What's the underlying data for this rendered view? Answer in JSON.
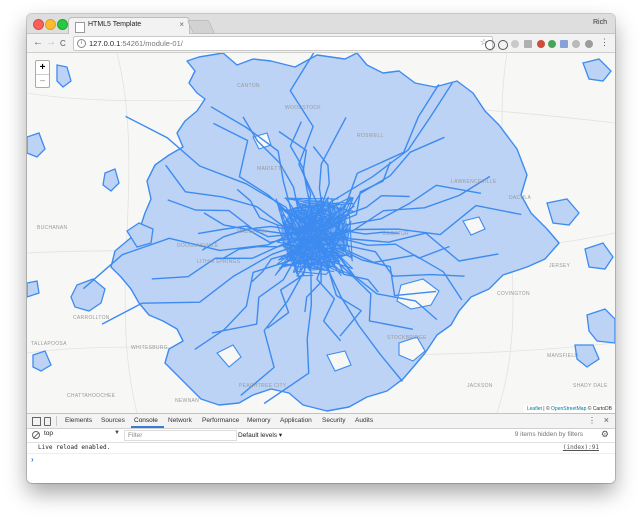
{
  "browser": {
    "tab_title": "HTML5 Template",
    "profile_name": "Rich",
    "url_host": "127.0.0.1",
    "url_rest": ":54261/module-01/",
    "nav_back": "←",
    "nav_forward": "→",
    "nav_reload": "C",
    "star": "☆",
    "menu": "⋮"
  },
  "map": {
    "zoom_in": "+",
    "zoom_out": "−",
    "attribution": {
      "leaflet": "Leaflet",
      "separator": " | © ",
      "osm": "OpenStreetMap",
      "carto": " © CartoDB"
    },
    "place_labels": [
      {
        "text": "WOODSTOCK"
      },
      {
        "text": "MARIETTA"
      },
      {
        "text": "MABLETON"
      },
      {
        "text": "DOUGLASVILLE"
      },
      {
        "text": "LITHIA SPRINGS"
      },
      {
        "text": "WHITESBURG"
      },
      {
        "text": "CARROLLTON"
      },
      {
        "text": "NEWNAN"
      },
      {
        "text": "PEACHTREE CITY"
      },
      {
        "text": "STOCKBRIDGE"
      },
      {
        "text": "DECATUR"
      },
      {
        "text": "LAWRENCEVILLE"
      },
      {
        "text": "DACULA"
      },
      {
        "text": "JERSEY"
      },
      {
        "text": "COVINGTON"
      },
      {
        "text": "MANSFIELD"
      },
      {
        "text": "JACKSON"
      },
      {
        "text": "SHADY DALE"
      },
      {
        "text": "BUCHANAN"
      },
      {
        "text": "CANTON"
      },
      {
        "text": "ROSWELL"
      },
      {
        "text": "TALLAPOOSA"
      },
      {
        "text": "CHATTAHOOCHEE"
      }
    ]
  },
  "devtools": {
    "tabs": [
      "Elements",
      "Sources",
      "Console",
      "Network",
      "Performance",
      "Memory",
      "Application",
      "Security",
      "Audits"
    ],
    "active_tab": "Console",
    "context": "top",
    "filter_placeholder": "Filter",
    "levels": "Default levels ▾",
    "hidden_info": "9 items hidden by filters",
    "messages": [
      {
        "text": "Live reload enabled.",
        "source": "(index):91"
      }
    ],
    "prompt": "›"
  },
  "colors": {
    "route_stroke": "#3d8bf0",
    "service_fill": "#bcd3f5",
    "map_bg": "#f7f7f5",
    "devtools_accent": "#3879d9"
  },
  "icons": [
    "info-icon",
    "star-icon",
    "inspect-icon",
    "device-icon",
    "clear-console-icon",
    "gear-icon",
    "close-icon",
    "kebab-menu-icon"
  ]
}
